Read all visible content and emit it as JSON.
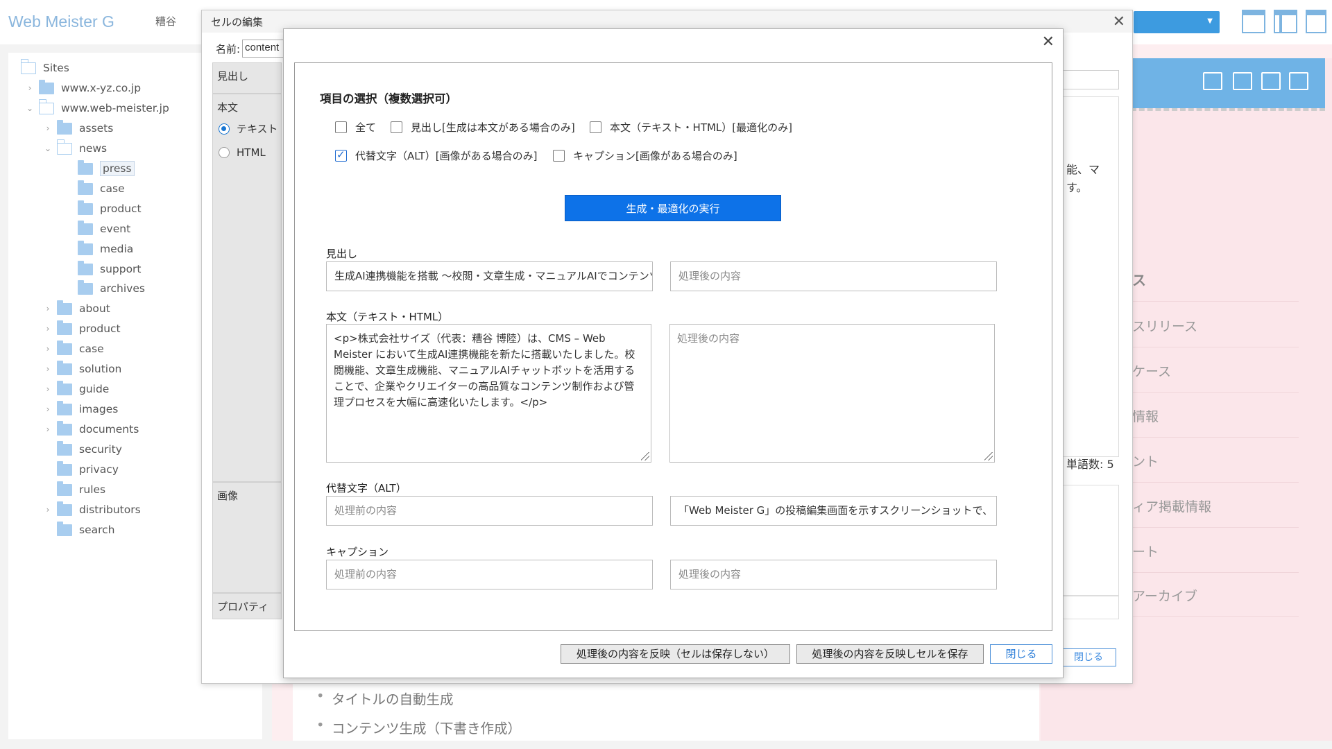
{
  "app": {
    "logo": "Web Meister G",
    "user": "糟谷"
  },
  "tree": {
    "root": "Sites",
    "items": [
      {
        "label": "www.x-yz.co.jp"
      },
      {
        "label": "www.web-meister.jp"
      },
      {
        "label": "assets"
      },
      {
        "label": "news"
      },
      {
        "label": "press"
      },
      {
        "label": "case"
      },
      {
        "label": "product"
      },
      {
        "label": "event"
      },
      {
        "label": "media"
      },
      {
        "label": "support"
      },
      {
        "label": "archives"
      },
      {
        "label": "about"
      },
      {
        "label": "product"
      },
      {
        "label": "case"
      },
      {
        "label": "solution"
      },
      {
        "label": "guide"
      },
      {
        "label": "images"
      },
      {
        "label": "documents"
      },
      {
        "label": "security"
      },
      {
        "label": "privacy"
      },
      {
        "label": "rules"
      },
      {
        "label": "distributors"
      },
      {
        "label": "search"
      }
    ]
  },
  "background": {
    "bullets": [
      "タイトルの自動生成",
      "コンテンツ生成（下書き作成）"
    ],
    "right_menu": {
      "head": "ス",
      "items": [
        "スリリース",
        "ケース",
        "情報",
        "ント",
        "ィア掲載情報",
        "ート",
        "アーカイブ"
      ]
    }
  },
  "cell_dialog": {
    "title": "セルの編集",
    "name_label": "名前:",
    "name_value": "content",
    "rows": {
      "heading": "見出し",
      "body": "本文",
      "image": "画像",
      "property": "プロパティ"
    },
    "radio_text": "テキスト",
    "radio_html": "HTML",
    "right_text_1": "能、マ",
    "right_text_2": "す。",
    "word_count": "単語数: 5",
    "close_button": "閉じる"
  },
  "gen_dialog": {
    "section_title": "項目の選択（複数選択可）",
    "checkboxes": {
      "all": {
        "label": "全て",
        "checked": false
      },
      "heading": {
        "label": "見出し[生成は本文がある場合のみ]",
        "checked": false
      },
      "body": {
        "label": "本文（テキスト・HTML）[最適化のみ]",
        "checked": false
      },
      "alt": {
        "label": "代替文字（ALT）[画像がある場合のみ]",
        "checked": true
      },
      "caption": {
        "label": "キャプション[画像がある場合のみ]",
        "checked": false
      }
    },
    "execute_button": "生成・最適化の実行",
    "fields": {
      "heading": {
        "label": "見出し",
        "before": "生成AI連携機能を搭載 ～校閲・文章生成・マニュアルAIでコンテンツ",
        "after_placeholder": "処理後の内容"
      },
      "body": {
        "label": "本文（テキスト・HTML）",
        "before": "<p>株式会社サイズ（代表：糟谷 博陸）は、CMS – Web Meister において生成AI連携機能を新たに搭載いたしました。校閲機能、文章生成機能、マニュアルAIチャットボットを活用することで、企業やクリエイターの高品質なコンテンツ制作および管理プロセスを大幅に高速化いたします。</p>",
        "after_placeholder": "処理後の内容"
      },
      "alt": {
        "label": "代替文字（ALT）",
        "before_placeholder": "処理前の内容",
        "after": "「Web Meister G」の投稿編集画面を示すスクリーンショットで、"
      },
      "caption": {
        "label": "キャプション",
        "before_placeholder": "処理前の内容",
        "after_placeholder": "処理後の内容"
      }
    },
    "buttons": {
      "apply": "処理後の内容を反映（セルは保存しない）",
      "apply_save": "処理後の内容を反映しセルを保存",
      "close": "閉じる"
    }
  },
  "colors": {
    "primary": "#0d72e8",
    "accent_blue": "#3d9be0",
    "pink_bg": "#fdeef0"
  }
}
